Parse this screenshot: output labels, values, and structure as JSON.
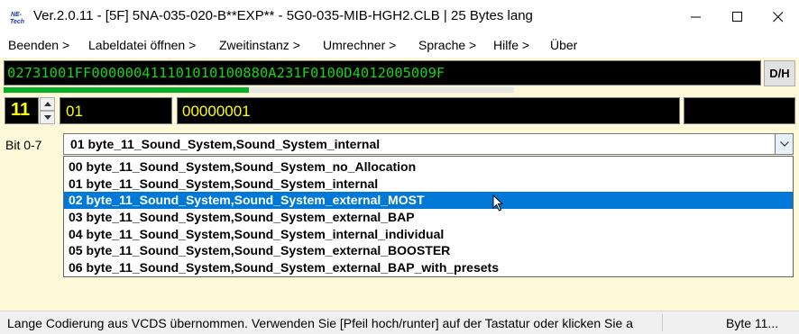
{
  "window": {
    "logo_text": "NE-Tech",
    "title": "Ver.2.0.11 - [5F] 5NA-035-020-B**EXP** - 5G0-035-MIB-HGH2.CLB | 25 Bytes lang",
    "controls": [
      "minimize",
      "maximize",
      "close"
    ]
  },
  "menu": [
    "Beenden >",
    "Labeldatei öffnen >",
    "Zweitinstanz >",
    "Umrechner >",
    "Sprache >",
    "Hilfe >",
    "Über"
  ],
  "coding": {
    "hex_string": "02731001FF000000411101010100880A231F0100D4012005009F",
    "dh_label": "D/H",
    "progress": 0.48
  },
  "byte_row": {
    "byte_index": "11",
    "hex_value": "01",
    "binary_value": "00000001",
    "extra_value": ""
  },
  "bit_selector": {
    "label": "Bit 0-7",
    "selected": "01 byte_11_Sound_System,Sound_System_internal",
    "highlighted_index": 2,
    "options": [
      "00 byte_11_Sound_System,Sound_System_no_Allocation",
      "01 byte_11_Sound_System,Sound_System_internal",
      "02 byte_11_Sound_System,Sound_System_external_MOST",
      "03 byte_11_Sound_System,Sound_System_external_BAP",
      "04 byte_11_Sound_System,Sound_System_internal_individual",
      "05 byte_11_Sound_System,Sound_System_external_BOOSTER",
      "06 byte_11_Sound_System,Sound_System_external_BAP_with_presets"
    ]
  },
  "status": {
    "message": "Lange Codierung aus VCDS übernommen. Verwenden Sie [Pfeil hoch/runter] auf der Tastatur oder klicken Sie a",
    "byte_info": "Byte 11..."
  },
  "colors": {
    "background": "#fdf8d8",
    "hex_text": "#19d119",
    "field_text": "#ffff00",
    "selection": "#0078d7",
    "progress": "#06b025"
  }
}
